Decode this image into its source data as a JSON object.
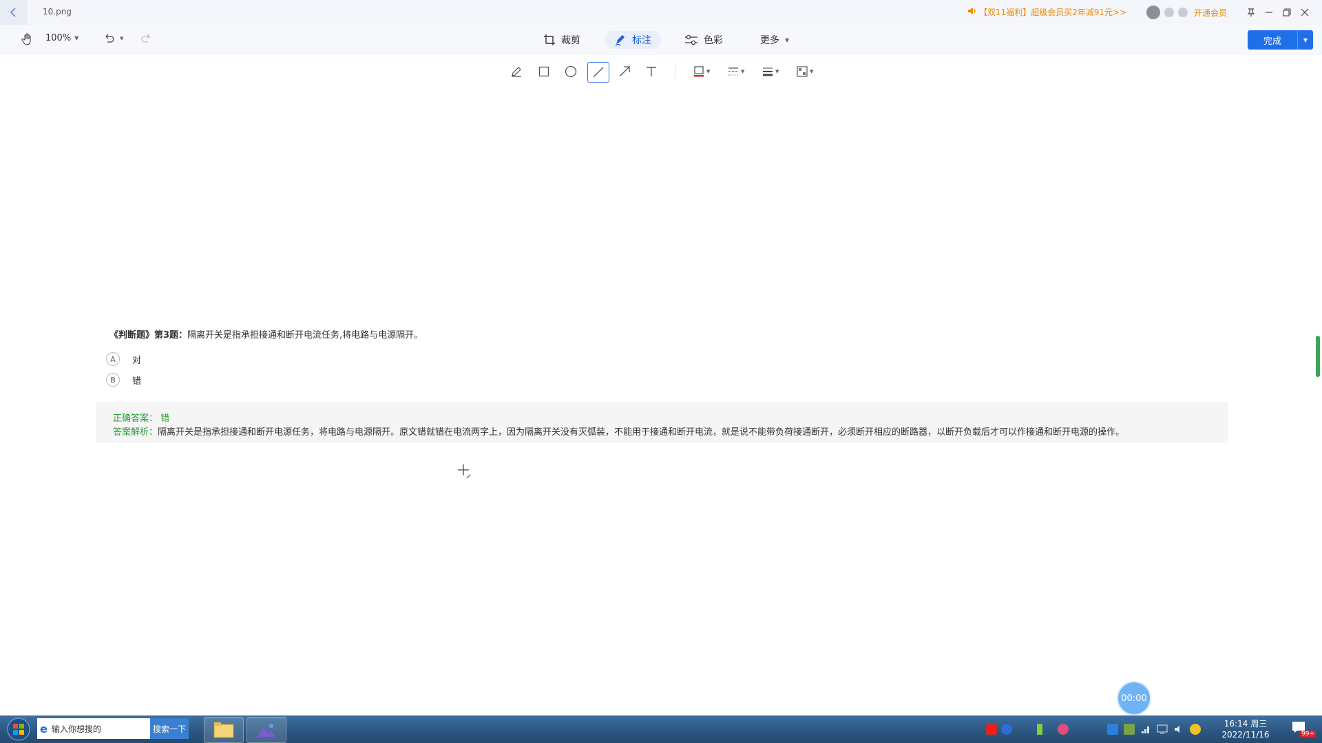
{
  "window": {
    "filename": "10.png",
    "promo": "【双11福利】超级会员买2年减91元>>",
    "vip_label": "开通会员"
  },
  "toolbar": {
    "zoom": "100%",
    "crop_label": "裁剪",
    "annotate_label": "标注",
    "color_label": "色彩",
    "more_label": "更多",
    "done_label": "完成"
  },
  "annotation_tools": {
    "active": "line",
    "items": [
      "pen-icon",
      "rectangle-icon",
      "ellipse-icon",
      "line-icon",
      "arrow-icon",
      "text-icon"
    ],
    "stroke_color": "#e02424"
  },
  "content": {
    "question_prefix": "《判断题》第3题：",
    "question_text": "隔离开关是指承担接通和断开电流任务,将电路与电源隔开。",
    "options": [
      {
        "key": "A",
        "text": "对"
      },
      {
        "key": "B",
        "text": "错"
      }
    ],
    "correct_label": "正确答案：",
    "correct_value": "错",
    "analysis_label": "答案解析：",
    "analysis_text": "隔离开关是指承担接通和断开电源任务，将电路与电源隔开。原文错就错在电流两字上，因为隔离开关没有灭弧装，不能用于接通和断开电流，就是说不能带负荷接通断开，必须断开相应的断路器，以断开负载后才可以作接通和断开电源的操作。"
  },
  "timer": "00:00",
  "taskbar": {
    "search_placeholder": "输入你想搜的",
    "search_button": "搜索一下",
    "time": "16:14 周三",
    "date": "2022/11/16",
    "notification_badge": "99+"
  },
  "colors": {
    "accent": "#1f6fe8",
    "promo": "#f08a00",
    "answer_green": "#2e9c3a"
  }
}
